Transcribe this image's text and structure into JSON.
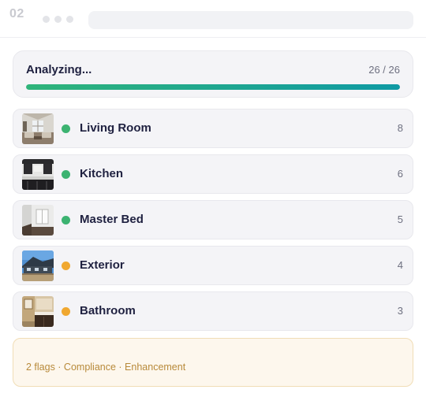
{
  "header": {
    "step_number": "02"
  },
  "analysis": {
    "title": "Analyzing...",
    "count_text": "26 / 26",
    "progress_fraction": 1.0
  },
  "colors": {
    "status_done": "#3cb371",
    "status_warning": "#f0a830",
    "progress_start": "#2fb47a",
    "progress_end": "#0f9aa4"
  },
  "rooms": [
    {
      "label": "Living Room",
      "count": "8",
      "status": "done",
      "thumb_icon": "living-room-photo"
    },
    {
      "label": "Kitchen",
      "count": "6",
      "status": "done",
      "thumb_icon": "kitchen-photo"
    },
    {
      "label": "Master Bed",
      "count": "5",
      "status": "done",
      "thumb_icon": "bedroom-photo"
    },
    {
      "label": "Exterior",
      "count": "4",
      "status": "warning",
      "thumb_icon": "exterior-photo"
    },
    {
      "label": "Bathroom",
      "count": "3",
      "status": "warning",
      "thumb_icon": "bathroom-photo"
    }
  ],
  "flags": {
    "text": "2 flags · Compliance · Enhancement"
  }
}
